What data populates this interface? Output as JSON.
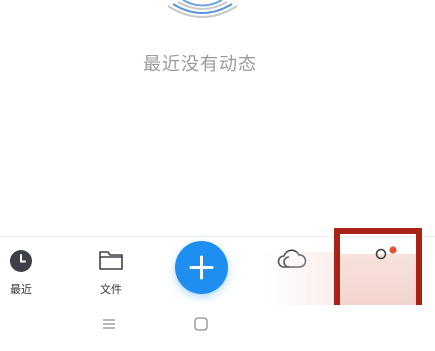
{
  "empty_state": {
    "message": "最近没有动态"
  },
  "tabbar": {
    "tabs": [
      {
        "label": "最近",
        "icon": "clock-icon",
        "selected": true
      },
      {
        "label": "文件",
        "icon": "folder-icon",
        "selected": false
      },
      {
        "label": "",
        "icon": "cloud-icon",
        "selected": false
      },
      {
        "label": "",
        "icon": "profile-icon",
        "selected": false,
        "badge": true
      }
    ],
    "add_button_icon": "plus-icon"
  },
  "system_nav": {
    "items": [
      "menu-icon",
      "home-icon"
    ]
  },
  "colors": {
    "accent": "#1f8ef1",
    "highlight_border": "#a82218",
    "badge": "#e2533b",
    "text_muted": "#9a9a9a"
  }
}
